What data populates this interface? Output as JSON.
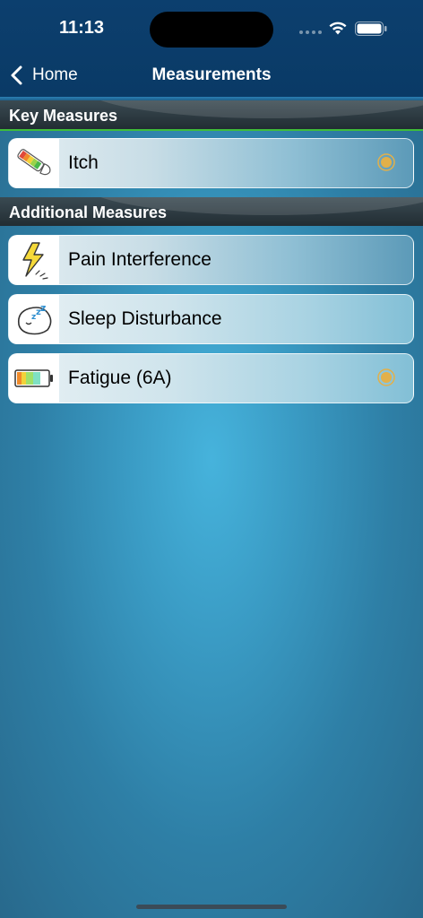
{
  "status_bar": {
    "time": "11:13"
  },
  "nav": {
    "back_label": "Home",
    "title": "Measurements"
  },
  "sections": {
    "key": {
      "label": "Key Measures",
      "items": [
        {
          "label": "Itch",
          "icon": "itch-arm-icon",
          "has_indicator": true
        }
      ]
    },
    "additional": {
      "label": "Additional Measures",
      "items": [
        {
          "label": "Pain Interference",
          "icon": "lightning-bolt-icon",
          "has_indicator": false
        },
        {
          "label": "Sleep Disturbance",
          "icon": "sleeping-head-icon",
          "has_indicator": false
        },
        {
          "label": "Fatigue (6A)",
          "icon": "battery-level-icon",
          "has_indicator": true
        }
      ]
    }
  },
  "colors": {
    "header": "#0a3a66",
    "section_accent": "#3fbe3a",
    "indicator": "#e2b04a"
  }
}
